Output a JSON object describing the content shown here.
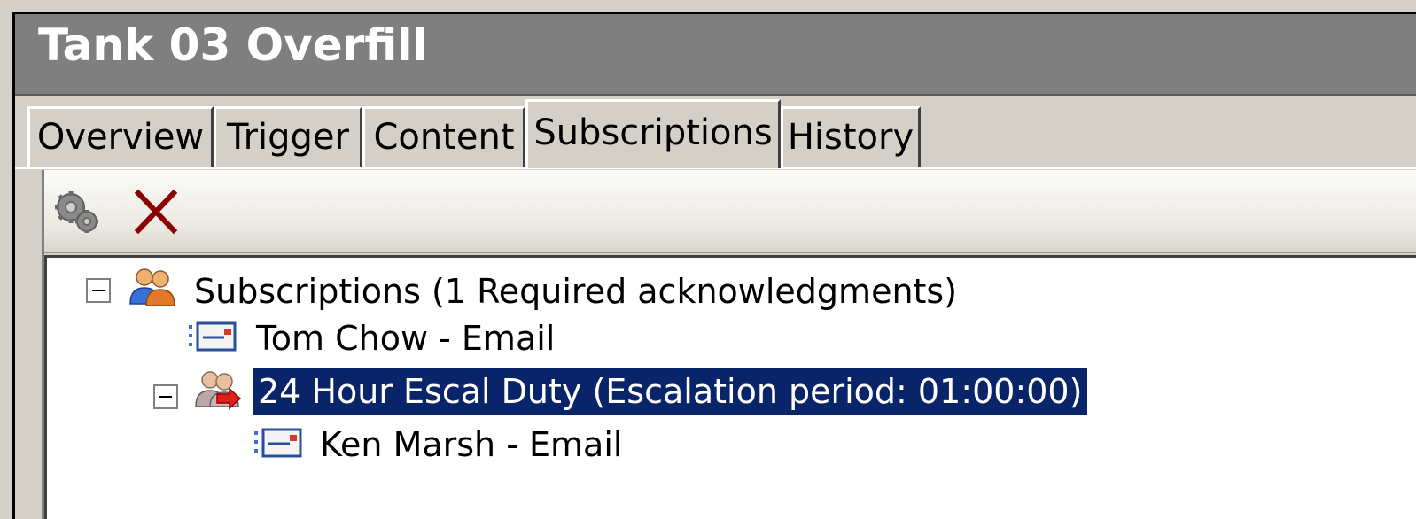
{
  "window": {
    "title": "Tank 03 Overfill"
  },
  "tabs": [
    {
      "label": "Overview",
      "active": false
    },
    {
      "label": "Trigger",
      "active": false
    },
    {
      "label": "Content",
      "active": false
    },
    {
      "label": "Subscriptions",
      "active": true
    },
    {
      "label": "History",
      "active": false
    }
  ],
  "toolbar": {
    "buttons": [
      {
        "icon": "properties-gear-icon"
      },
      {
        "icon": "delete-x-icon"
      }
    ]
  },
  "tree": {
    "root": {
      "label": "Subscriptions (1 Required acknowledgments)",
      "icon": "group-users-icon",
      "expanded": true
    },
    "items": [
      {
        "label": "Tom Chow - Email",
        "icon": "email-icon"
      },
      {
        "label": "24 Hour Escal Duty (Escalation period: 01:00:00)",
        "icon": "escalation-group-icon",
        "expanded": true,
        "selected": true
      },
      {
        "label": "Ken Marsh - Email",
        "icon": "email-icon"
      }
    ]
  },
  "colors": {
    "selection": "#0a246a",
    "titlebar": "#7f7f7f",
    "delete": "#8b0000"
  }
}
